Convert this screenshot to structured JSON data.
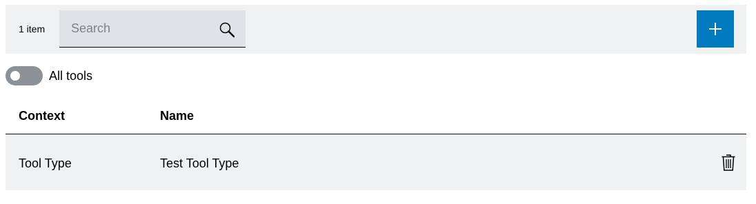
{
  "toolbar": {
    "item_count": "1 item",
    "search": {
      "placeholder": "Search",
      "value": ""
    },
    "add_button_icon": "plus-icon",
    "accent_color": "#007bc0"
  },
  "filter": {
    "toggle_label": "All tools",
    "toggle_on": false
  },
  "table": {
    "columns": [
      "Context",
      "Name"
    ],
    "rows": [
      {
        "context": "Tool Type",
        "name": "Test Tool Type",
        "action_icon": "trash-icon"
      }
    ]
  }
}
